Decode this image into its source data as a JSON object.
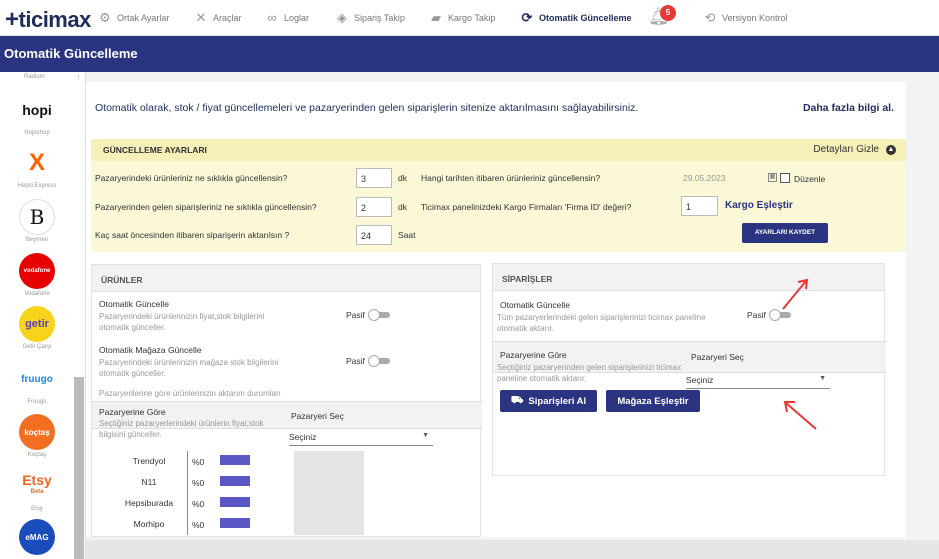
{
  "brand": {
    "logo_text": "ticimax"
  },
  "topnav": {
    "items": [
      {
        "label": "Ortak Ayarlar",
        "icon": "gear-icon"
      },
      {
        "label": "Araçlar",
        "icon": "tools-icon"
      },
      {
        "label": "Loglar",
        "icon": "log-icon"
      },
      {
        "label": "Sipariş Takip",
        "icon": "box-icon"
      },
      {
        "label": "Kargo Takip",
        "icon": "truck-icon"
      },
      {
        "label": "Otomatik Güncelleme",
        "icon": "sync-icon"
      },
      {
        "label": "Versiyon Kontrol",
        "icon": "refresh-icon"
      }
    ],
    "notification_count": "5"
  },
  "page": {
    "title": "Otomatik Güncelleme"
  },
  "sidebar": {
    "top_label": "Radium",
    "items": [
      {
        "label": "Hopishop",
        "logo": "hopi",
        "color": "#ffffff"
      },
      {
        "label": "Hepsi Express",
        "logo": "X",
        "color": "#ffffff"
      },
      {
        "label": "Beymen",
        "logo": "B",
        "color": "#ffffff"
      },
      {
        "label": "Vodafone",
        "logo": "vodafone",
        "color": "#e60000"
      },
      {
        "label": "Getir Çarşı",
        "logo": "getir",
        "color": "#f7d31b"
      },
      {
        "label": "Fruugo",
        "logo": "fruugo",
        "color": "#ffffff"
      },
      {
        "label": "Koçtaş",
        "logo": "koçtaş",
        "color": "#f26f21"
      },
      {
        "label": "Etsy",
        "logo": "Etsy",
        "sub": "Beta",
        "color": "#ffffff"
      },
      {
        "label": "eMAG",
        "logo": "eMAG",
        "color": "#1a4dbb"
      }
    ]
  },
  "intro": {
    "text": "Otomatik olarak, stok / fiyat güncellemeleri ve pazaryerinden gelen siparişlerin sitenize aktarılmasını sağlayabilirsiniz.",
    "more_link": "Daha fazla bilgi al."
  },
  "settings": {
    "title": "GÜNCELLEME AYARLARI",
    "hide_label": "Detayları Gizle",
    "q1": "Pazaryerindeki ürünleriniz ne sıklıkla güncellensin?",
    "q1_value": "3",
    "q1_unit": "dk",
    "q2": "Pazaryerinden gelen siparişleriniz ne sıklıkla güncellensin?",
    "q2_value": "2",
    "q2_unit": "dk",
    "q3": "Kaç saat öncesinden itibaren siparişerin aktarılsın ?",
    "q3_value": "24",
    "q3_unit": "Saat",
    "q4": "Hangi tarihten itibaren ürünleriniz güncellensin?",
    "q4_date": "29.05.2023",
    "edit_label": "Düzenle",
    "q5": "Ticimax panelinizdeki Kargo Firmaları 'Firma ID' değeri?",
    "q5_value": "1",
    "cargo_link": "Kargo Eşleştir",
    "save_button": "AYARLARI KAYDET"
  },
  "products": {
    "title": "ÜRÜNLER",
    "auto_title": "Otomatik Güncelle",
    "auto_desc": "Pazaryerindeki ürünlerinizin fiyat,stok bilgilerini otomatik günceller.",
    "auto_state": "Pasif",
    "store_title": "Otomatik Mağaza Güncelle",
    "store_desc": "Pazaryerindeki ürünlerinizin mağaza stok bilgilerini otomatik günceller.",
    "store_state": "Pasif",
    "status_note": "Pazaryerilerine göre ürünlerinizin aktarım durumları",
    "market_title": "Pazaryerine Göre",
    "market_desc": "Seçtiğiniz pazaryerlerindeki ürünlerin fiyat,stok bilgisini günceller.",
    "market_select_label": "Pazaryeri Seç",
    "market_select_value": "Seçiniz",
    "markets": [
      {
        "name": "Trendyol",
        "pct": "%0"
      },
      {
        "name": "N11",
        "pct": "%0"
      },
      {
        "name": "Hepsiburada",
        "pct": "%0"
      },
      {
        "name": "Morhipo",
        "pct": "%0"
      }
    ]
  },
  "orders": {
    "title": "SİPARİŞLER",
    "auto_title": "Otomatik Güncelle",
    "auto_desc": "Tüm pazaryerlerindeki gelen siparişlerinizi ticimax paneline otomatik aktarır.",
    "auto_state": "Pasif",
    "market_title": "Pazaryerine Göre",
    "market_desc": "Seçtiğiniz pazaryerinden gelen siparişlerinizi ticimax paneline otomatik aktarır.",
    "market_select_label": "Pazaryeri Seç",
    "market_select_value": "Seçiniz",
    "fetch_button": "Siparişleri Al",
    "match_button": "Mağaza Eşleştir"
  },
  "colors": {
    "brand_navy": "#2a3480",
    "settings_bg": "#fbf8d8",
    "bar_purple": "#5b57c7",
    "annotation_red": "#e53935"
  }
}
